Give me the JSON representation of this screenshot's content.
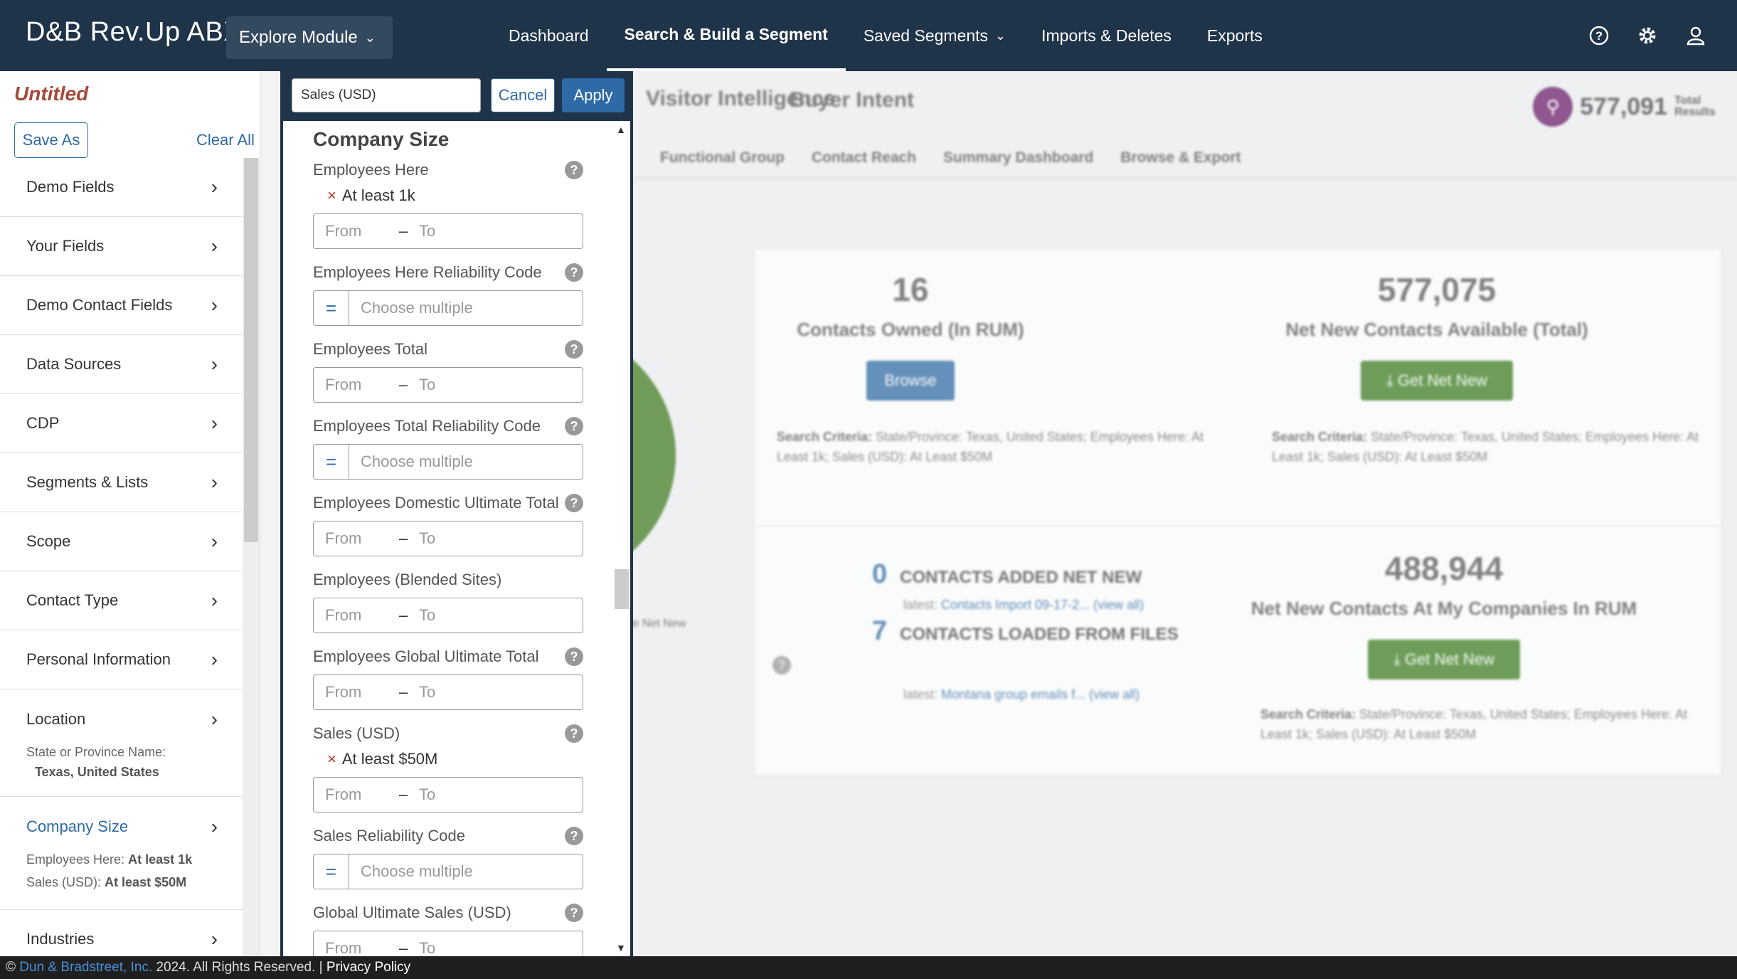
{
  "nav": {
    "brand": "D&B Rev.Up ABX",
    "module": "Explore Module",
    "links": [
      "Dashboard",
      "Search & Build a Segment",
      "Saved Segments",
      "Imports & Deletes",
      "Exports"
    ],
    "icons": [
      "help-icon",
      "gear-icon",
      "user-icon"
    ]
  },
  "sidebar": {
    "title": "Untitled",
    "save_as": "Save As",
    "clear_all": "Clear All",
    "categories": [
      {
        "label": "Demo Fields"
      },
      {
        "label": "Your Fields"
      },
      {
        "label": "Demo Contact Fields"
      },
      {
        "label": "Data Sources"
      },
      {
        "label": "CDP"
      },
      {
        "label": "Segments & Lists"
      },
      {
        "label": "Scope"
      },
      {
        "label": "Contact Type"
      },
      {
        "label": "Personal Information"
      },
      {
        "label": "Location",
        "criteria": [
          {
            "name": "State or Province Name:",
            "value": "Texas, United States"
          }
        ]
      },
      {
        "label": "Company Size",
        "criteria": [
          {
            "name": "Employees Here:",
            "value": "At least 1k"
          },
          {
            "name": "Sales (USD):",
            "value": "At least $50M"
          }
        ]
      },
      {
        "label": "Industries"
      }
    ]
  },
  "panel": {
    "filter_value": "Sales (USD)",
    "cancel": "Cancel",
    "apply": "Apply",
    "section": "Company Size",
    "from_placeholder": "From",
    "to_placeholder": "To",
    "dash": "–",
    "multi_placeholder": "Choose multiple",
    "eq": "=",
    "fields": [
      {
        "label": "Employees Here",
        "chip": "At least 1k"
      },
      {
        "label": "Employees Here Reliability Code"
      },
      {
        "label": "Employees Total"
      },
      {
        "label": "Employees Total Reliability Code"
      },
      {
        "label": "Employees Domestic Ultimate Total"
      },
      {
        "label": "Employees (Blended Sites)"
      },
      {
        "label": "Employees Global Ultimate Total"
      },
      {
        "label": "Sales (USD)",
        "chip": "At least $50M"
      },
      {
        "label": "Sales Reliability Code"
      },
      {
        "label": "Global Ultimate Sales (USD)"
      }
    ]
  },
  "main": {
    "visitor_logo": "Visitor Intelligence",
    "buyer_logo": "Buyer Intent",
    "total_count": "577,091",
    "total_label": "Total Results",
    "tabs": [
      "Functional Group",
      "Contact Reach",
      "Summary Dashboard",
      "Browse & Export"
    ],
    "donut_label": "le Net New",
    "owned": {
      "count": "16",
      "label": "Contacts Owned (In RUM)",
      "button": "Browse"
    },
    "available": {
      "count": "577,075",
      "label": "Net New Contacts Available (Total)",
      "button": "Get Net New"
    },
    "criteria_label": "Search Criteria:",
    "criteria_text": "State/Province: Texas, United States; Employees Here: At Least 1k; Sales (USD): At Least $50M",
    "added": {
      "count": "0",
      "label": "CONTACTS ADDED NET NEW",
      "latest": "latest:",
      "latest_link": "Contacts Import 09-17-2...",
      "view_all": "(view all)"
    },
    "loaded": {
      "count": "7",
      "label": "CONTACTS LOADED FROM FILES",
      "latest": "latest:",
      "latest_link": "Montana group emails f...",
      "view_all": "(view all)"
    },
    "rum": {
      "count": "488,944",
      "label": "Net New Contacts At My Companies In RUM",
      "button": "Get Net New"
    }
  },
  "footer": {
    "copy": "©",
    "company": "Dun & Bradstreet, Inc.",
    "rights": "2024. All Rights Reserved. |",
    "privacy": "Privacy Policy"
  }
}
